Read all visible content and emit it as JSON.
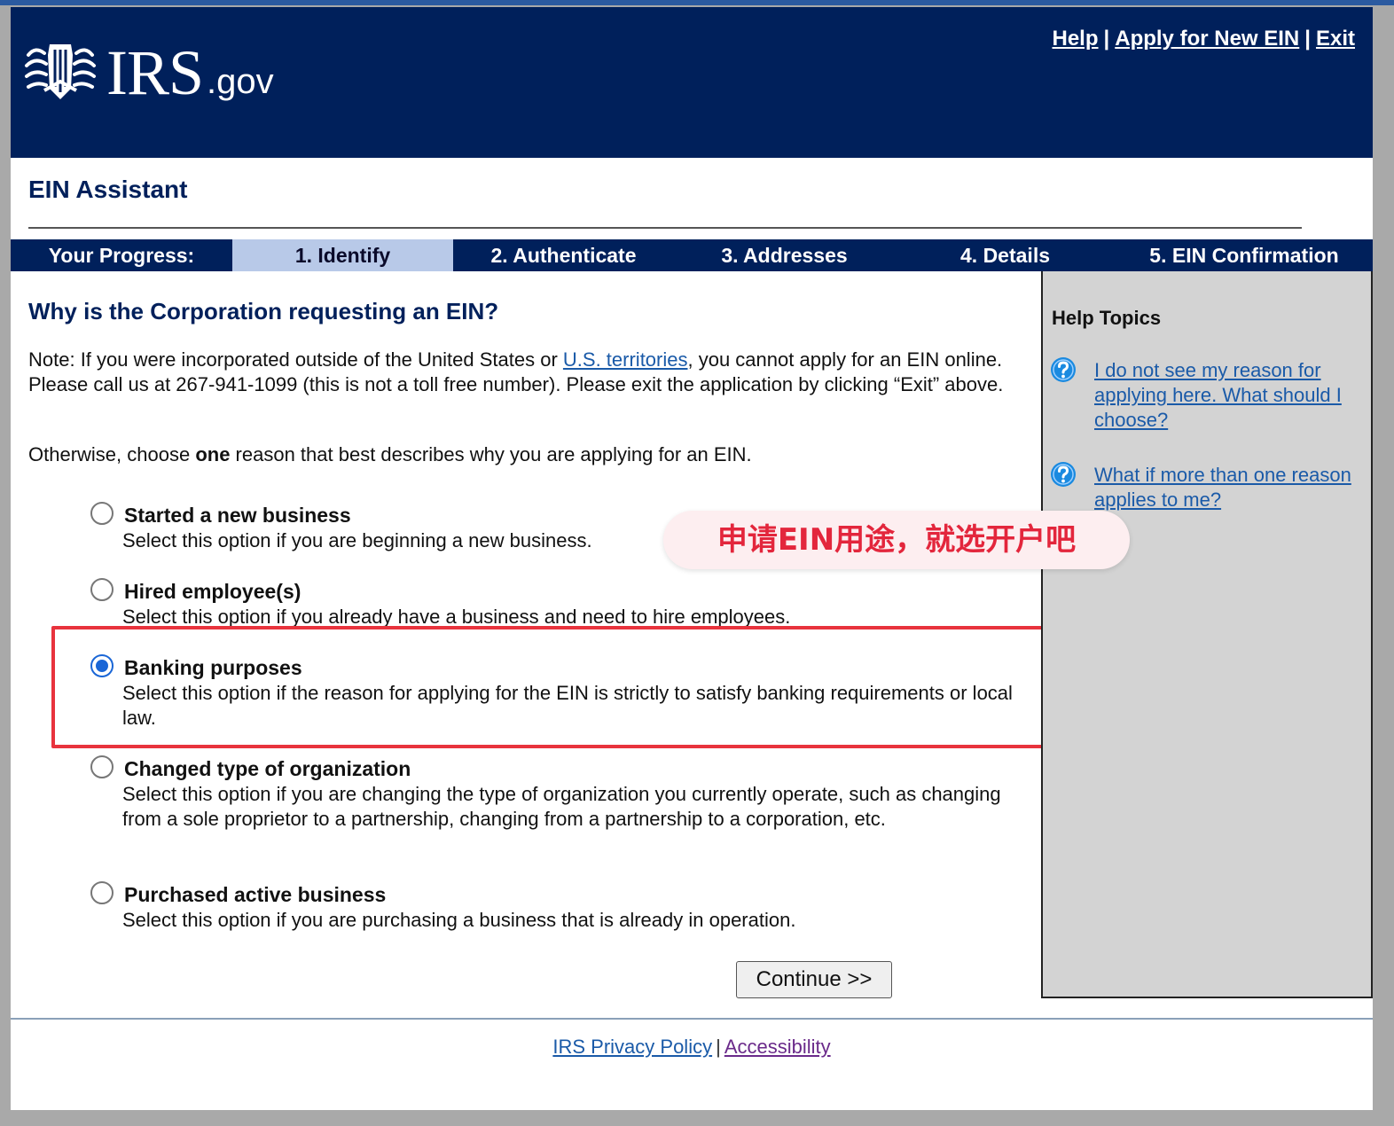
{
  "header": {
    "logo_irs": "IRS",
    "logo_gov": ".gov",
    "links": {
      "help": "Help",
      "apply": "Apply for New EIN",
      "exit": "Exit",
      "separator": "|"
    }
  },
  "app_title": "EIN Assistant",
  "progress": {
    "label": "Your Progress:",
    "steps": [
      "1. Identify",
      "2. Authenticate",
      "3. Addresses",
      "4. Details",
      "5. EIN Confirmation"
    ],
    "active_step": "1. Identify"
  },
  "main": {
    "question": "Why is the Corporation requesting an EIN?",
    "note_before": "Note: If you were incorporated outside of the United States or ",
    "note_link": "U.S. territories",
    "note_after": ", you cannot apply for an EIN online. Please call us at 267-941-1099 (this is not a toll free number). Please exit the application by clicking “Exit” above.",
    "instruction_before": "Otherwise, choose ",
    "instruction_bold": "one",
    "instruction_after": " reason that best describes why you are applying for an EIN.",
    "options": [
      {
        "label": "Started a new business",
        "description": "Select this option if you are beginning a new business.",
        "selected": false
      },
      {
        "label": "Hired employee(s)",
        "description": "Select this option if you already have a business and need to hire employees.",
        "selected": false
      },
      {
        "label": "Banking purposes",
        "description": "Select this option if the reason for applying for the EIN is strictly to satisfy banking requirements or local law.",
        "selected": true
      },
      {
        "label": "Changed type of organization",
        "description": "Select this option if you are changing the type of organization you currently operate, such as changing from a sole proprietor to a partnership, changing from a partnership to a corporation, etc.",
        "selected": false
      },
      {
        "label": "Purchased active business",
        "description": "Select this option if you are purchasing a business that is already in operation.",
        "selected": false
      }
    ],
    "continue_label": "Continue >>"
  },
  "help": {
    "title": "Help Topics",
    "topics": [
      "I do not see my reason for applying here. What should I choose?",
      "What if more than one reason applies to me?"
    ]
  },
  "callout": "申请EIN用途，就选开户吧",
  "footer": {
    "privacy": "IRS Privacy Policy",
    "separator": "|",
    "accessibility": "Accessibility"
  },
  "colors": {
    "navy": "#00205b",
    "active_step": "#b8c9e8",
    "link": "#1a5aa8",
    "highlight": "#e8333d",
    "sidebar": "#d3d3d3"
  },
  "icons": {
    "logo": "irs-eagle-logo-icon",
    "help": "question-mark-icon"
  }
}
